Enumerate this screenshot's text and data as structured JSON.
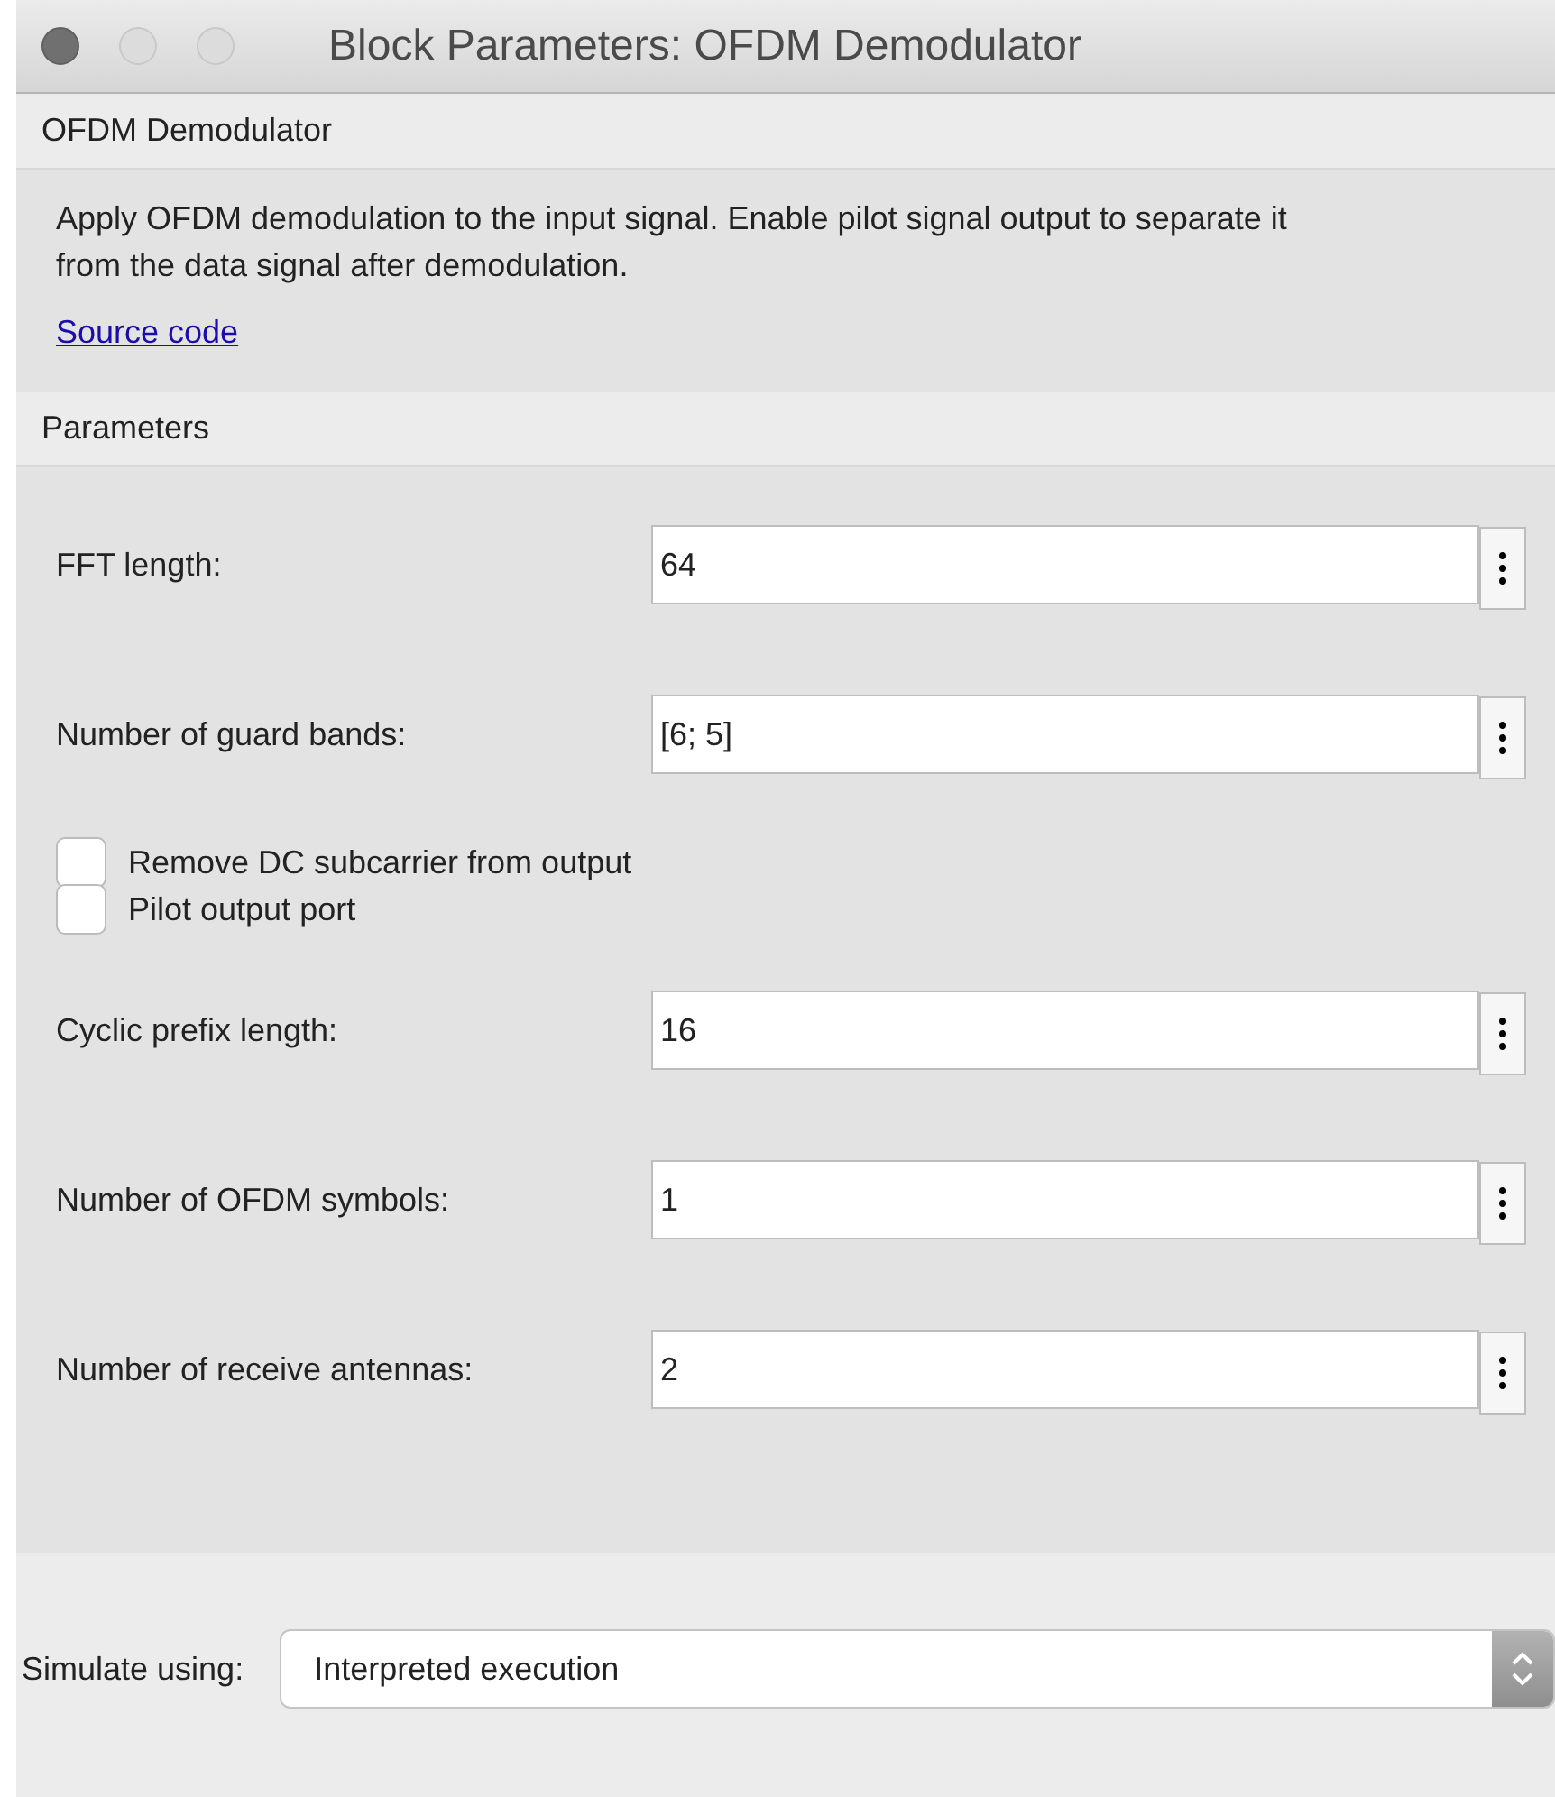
{
  "window": {
    "title": "Block Parameters: OFDM Demodulator"
  },
  "block": {
    "name": "OFDM Demodulator",
    "description": "Apply OFDM demodulation to the input signal. Enable pilot signal output to separate it from the data signal after demodulation.",
    "link": "Source code"
  },
  "parameters": {
    "title": "Parameters",
    "items": [
      {
        "kind": "field",
        "label": "FFT length:",
        "value": "64"
      },
      {
        "kind": "field",
        "label": "Number of guard bands:",
        "value": "[6; 5]"
      },
      {
        "kind": "checkbox",
        "label": "Remove DC subcarrier from output",
        "checked": false
      },
      {
        "kind": "checkbox",
        "label": "Pilot output port",
        "checked": false
      },
      {
        "kind": "field",
        "label": "Cyclic prefix length:",
        "value": "16"
      },
      {
        "kind": "field",
        "label": "Number of OFDM symbols:",
        "value": "1"
      },
      {
        "kind": "field",
        "label": "Number of receive antennas:",
        "value": "2"
      }
    ]
  },
  "simulate": {
    "label": "Simulate using:",
    "value": "Interpreted execution"
  }
}
